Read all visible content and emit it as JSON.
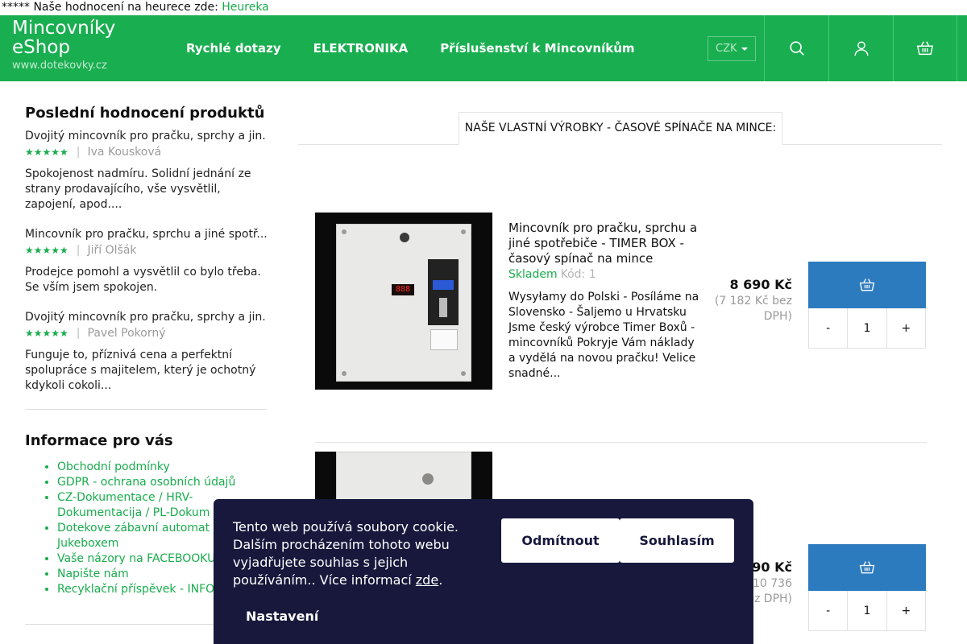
{
  "topstrip": {
    "text": "***** Naše hodnocení na heurece zde: ",
    "link": "Heureka"
  },
  "header": {
    "logo_line1": "Mincovníky",
    "logo_line2": "eShop",
    "logo_url": "www.dotekovky.cz",
    "nav": [
      "Rychlé dotazy",
      "ELEKTRONIKA",
      "Příslušenství k Mincovníkům"
    ],
    "currency": "CZK",
    "icons": [
      "search-icon",
      "user-icon",
      "cart-icon"
    ]
  },
  "sidebar": {
    "reviews_title": "Poslední hodnocení produktů",
    "reviews": [
      {
        "product": "Dvojitý mincovník pro pračku, sprchy a jin...",
        "stars": "★★★★★",
        "author": "Iva Kousková",
        "text": "Spokojenost nadmíru. Solidní jednání ze strany prodavajícího, vše vysvětlil, zapojení, apod...."
      },
      {
        "product": "Mincovník pro pračku, sprchu a jiné spotř...",
        "stars": "★★★★★",
        "author": "Jiří Olšák",
        "text": "Prodejce pomohl a vysvětlil co bylo třeba. Se vším jsem spokojen."
      },
      {
        "product": "Dvojitý mincovník pro pračku, sprchy a jin...",
        "stars": "★★★★★",
        "author": "Pavel Pokorný",
        "text": "Funguje to, příznivá cena a perfektní spolupráce s majitelem, který je ochotný kdykoli cokoli..."
      }
    ],
    "info_title": "Informace pro vás",
    "info_links": [
      "Obchodní podmínky",
      "GDPR - ochrana osobních údajů",
      "CZ-Dokumentace / HRV-Dokumentacija / PL-Dokum",
      "Dotekove zábavní automat",
      "Jukeboxem",
      "Vaše názory na FACEBOOKU",
      "Napište nám",
      "Recyklační příspěvek - INFO"
    ]
  },
  "main": {
    "tab": "NAŠE VLASTNÍ VÝROBKY - ČASOVÉ SPÍNAČE NA MINCE:",
    "products": [
      {
        "name": "Mincovník pro pračku, sprchu a jiné spotřebiče - TIMER BOX - časový spínač na mince",
        "stock": "Skladem",
        "code": "Kód: 1",
        "desc": "Wysyłamy do Polski - Posíláme na Slovensko - Šaljemo u Hrvatsku Jsme český výrobce Timer Boxů - mincovníků Pokryje Vám náklady a vydělá na novou pračku!  Velice snadné...",
        "price": "8 690 Kč",
        "price_ex_line1": "(7 182 Kč bez",
        "price_ex_line2": "DPH)",
        "qty": "1",
        "minus": "-",
        "plus": "+",
        "display": "888"
      },
      {
        "name": "",
        "price": "90 Kč",
        "price_ex_line1": "(10 736",
        "price_ex_line2": "ez DPH)",
        "qty": "1",
        "minus": "-",
        "plus": "+"
      }
    ]
  },
  "cookie": {
    "text": "Tento web používá soubory cookie. Dalším procházením tohoto webu vyjadřujete souhlas s jejich používáním.. Více informací ",
    "link": "zde",
    "after": ".",
    "decline": "Odmítnout",
    "accept": "Souhlasím",
    "settings": "Nastavení"
  }
}
